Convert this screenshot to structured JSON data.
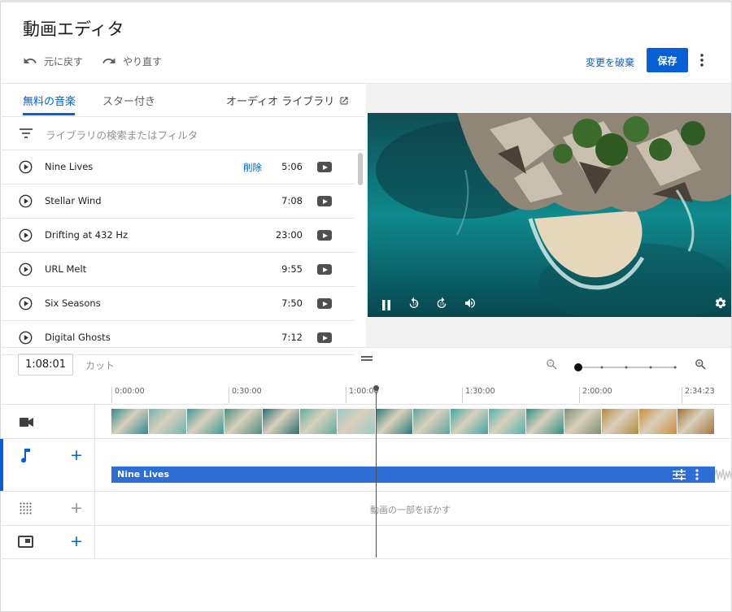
{
  "header": {
    "title": "動画エディタ",
    "undo_label": "元に戻す",
    "redo_label": "やり直す",
    "discard_label": "変更を破棄",
    "save_label": "保存"
  },
  "library": {
    "tabs": [
      {
        "label": "無料の音楽",
        "active": true
      },
      {
        "label": "スター付き",
        "active": false
      }
    ],
    "audio_library_link": "オーディオ ライブラリ",
    "filter_placeholder": "ライブラリの検索またはフィルタ",
    "tracks": [
      {
        "name": "Nine Lives",
        "duration": "5:06",
        "action": "削除"
      },
      {
        "name": "Stellar Wind",
        "duration": "7:08"
      },
      {
        "name": "Drifting at 432 Hz",
        "duration": "23:00"
      },
      {
        "name": "URL Melt",
        "duration": "9:55"
      },
      {
        "name": "Six Seasons",
        "duration": "7:50"
      },
      {
        "name": "Digital Ghosts",
        "duration": "7:12"
      }
    ]
  },
  "player": {
    "controls": [
      "pause-icon",
      "rewind-10-icon",
      "forward-10-icon",
      "volume-icon",
      "settings-icon"
    ]
  },
  "timeline": {
    "current_time": "1:08:01",
    "cut_label": "カット",
    "ruler": [
      "0:00:00",
      "0:30:00",
      "1:00:00",
      "1:30:00",
      "2:00:00",
      "2:34:23"
    ],
    "audio_track_label": "Nine Lives",
    "blur_label": "動画の一部をぼかす"
  },
  "colors": {
    "accent": "#065fd4",
    "audio_bar": "#2c6ed4"
  }
}
